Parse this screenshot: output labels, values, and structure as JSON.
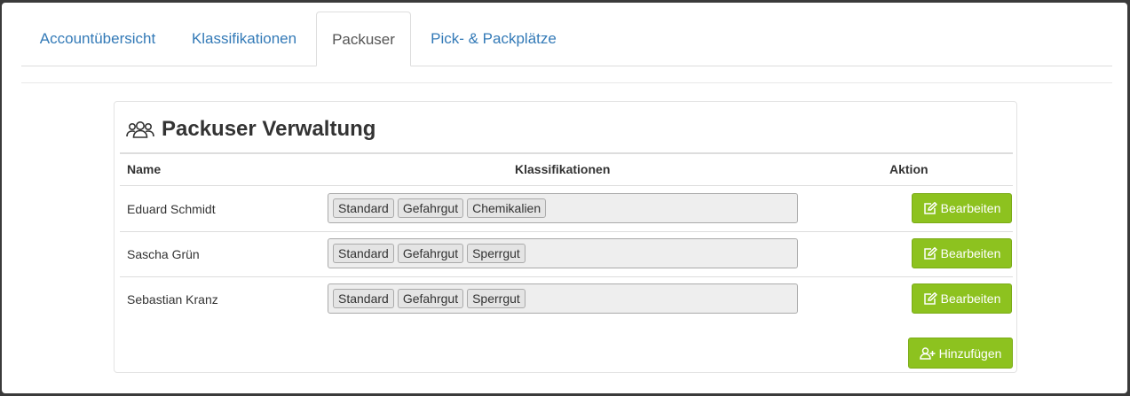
{
  "tabs": [
    {
      "label": "Accountübersicht",
      "active": false
    },
    {
      "label": "Klassifikationen",
      "active": false
    },
    {
      "label": "Packuser",
      "active": true
    },
    {
      "label": "Pick- & Packplätze",
      "active": false
    }
  ],
  "panel": {
    "title": "Packuser Verwaltung",
    "title_icon": "users-icon"
  },
  "table": {
    "headers": {
      "name": "Name",
      "classifications": "Klassifikationen",
      "action": "Aktion"
    },
    "rows": [
      {
        "name": "Eduard Schmidt",
        "tags": [
          "Standard",
          "Gefahrgut",
          "Chemikalien"
        ],
        "action_label": "Bearbeiten"
      },
      {
        "name": "Sascha Grün",
        "tags": [
          "Standard",
          "Gefahrgut",
          "Sperrgut"
        ],
        "action_label": "Bearbeiten"
      },
      {
        "name": "Sebastian Kranz",
        "tags": [
          "Standard",
          "Gefahrgut",
          "Sperrgut"
        ],
        "action_label": "Bearbeiten"
      }
    ]
  },
  "add_button": {
    "label": "Hinzufügen",
    "icon": "user-plus-icon"
  },
  "colors": {
    "link": "#337ab7",
    "accent_green": "#8dc21f",
    "text": "#333333"
  }
}
